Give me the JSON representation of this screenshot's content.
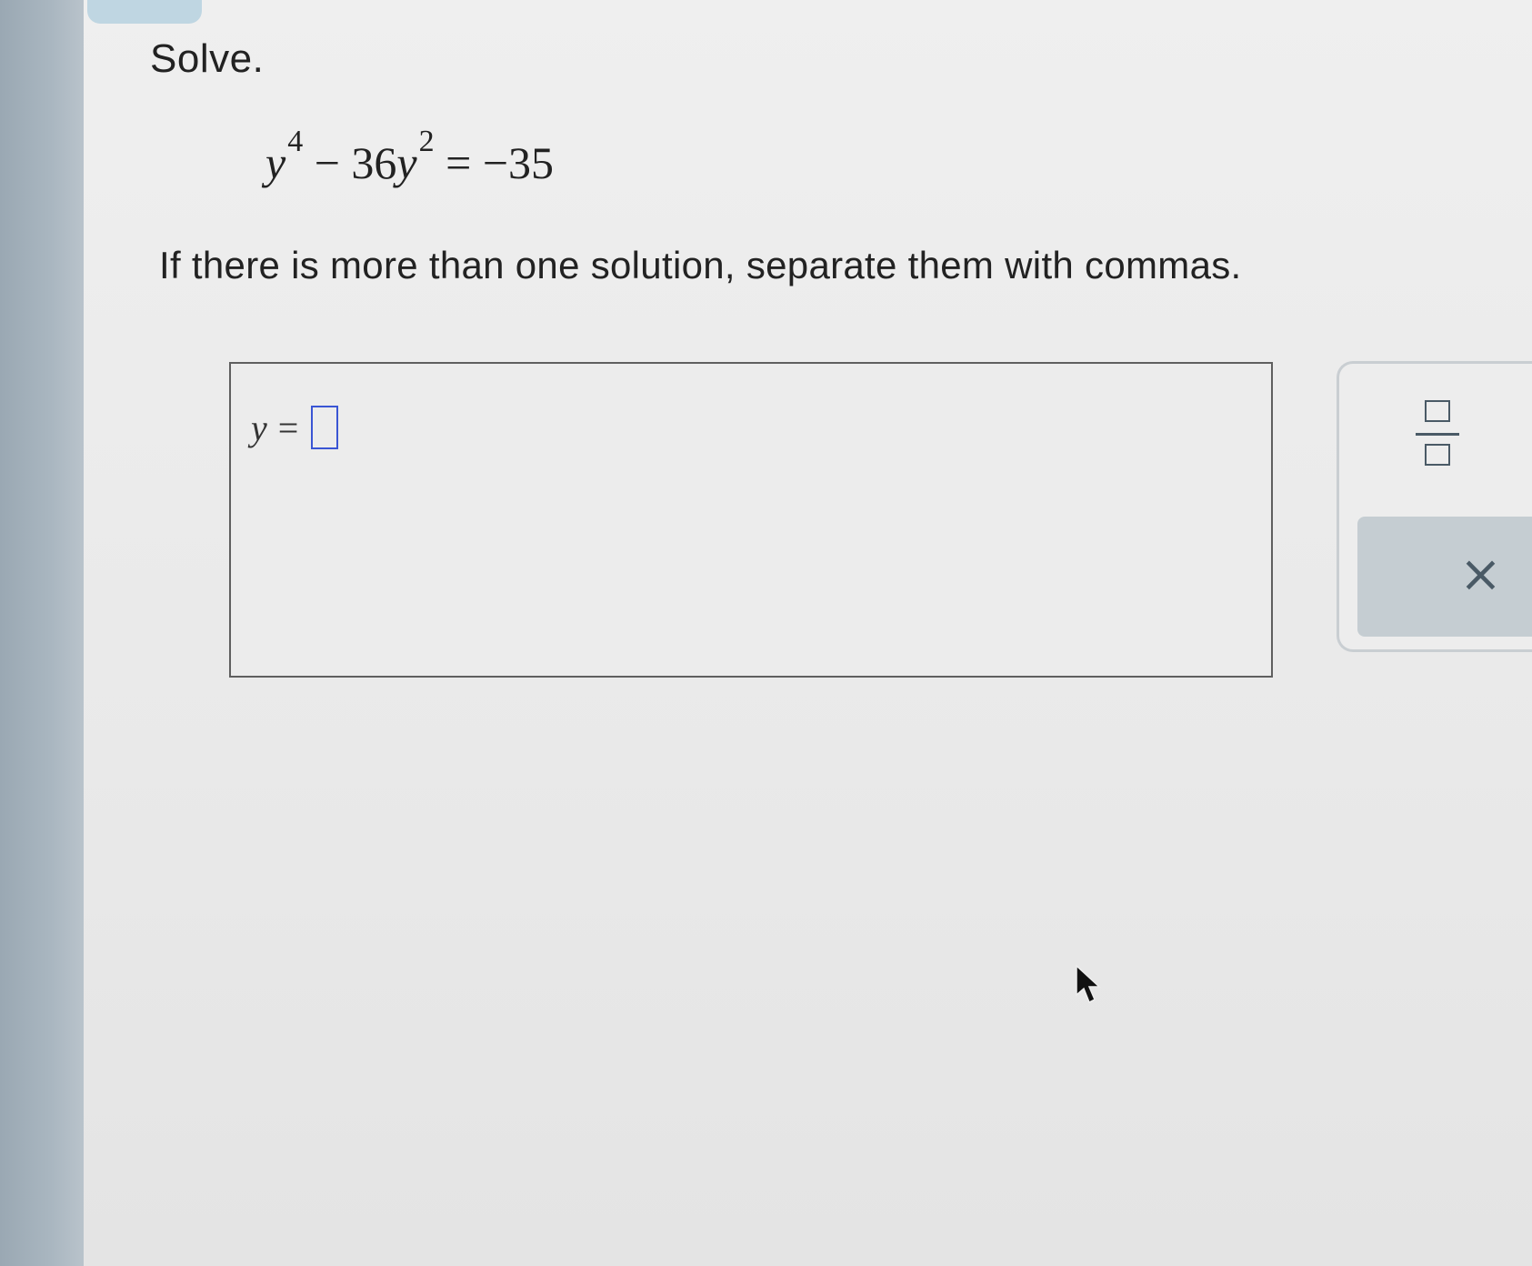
{
  "problem": {
    "title": "Solve.",
    "equation": {
      "term1_var": "y",
      "term1_exp": "4",
      "minus_sign": "−",
      "term2_coef": "36",
      "term2_var": "y",
      "term2_exp": "2",
      "equals": "=",
      "rhs": "−35"
    },
    "instructions": "If there is more than one solution, separate them with commas."
  },
  "answer": {
    "variable": "y",
    "equals": "=",
    "value": ""
  },
  "tools": {
    "fraction_icon": "fraction-template-icon",
    "clear_symbol": "×"
  },
  "colors": {
    "input_border": "#3a55d4",
    "tool_icon": "#4a5a66",
    "clear_button_bg": "#c5cdd2"
  }
}
